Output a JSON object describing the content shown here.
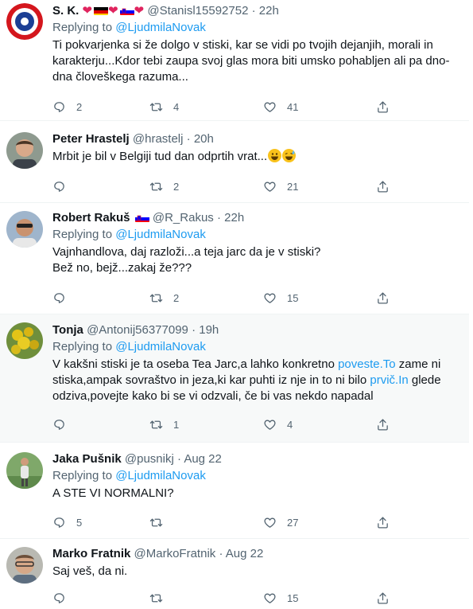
{
  "tweets": [
    {
      "name": "S. K.",
      "handle": "@Stanisl15592752",
      "time": "22h",
      "replying_prefix": "Replying to",
      "replying_to": "@LjudmilaNovak",
      "text": "Ti pokvarjenka si že dolgo v stiski, kar se vidi po tvojih dejanjih, morali in karakterju...Kdor tebi zaupa svoj glas mora biti umsko pohabljen ali pa dno-dna človeškega razuma...",
      "replies": "2",
      "retweets": "4",
      "likes": "41"
    },
    {
      "name": "Peter Hrastelj",
      "handle": "@hrastelj",
      "time": "20h",
      "text": "Mrbit je bil v Belgiji tud dan odprtih vrat...",
      "replies": "",
      "retweets": "2",
      "likes": "21"
    },
    {
      "name": "Robert Rakuš",
      "handle": "@R_Rakus",
      "time": "22h",
      "replying_prefix": "Replying to",
      "replying_to": "@LjudmilaNovak",
      "text_line1": "Vajnhandlova, daj razloži...a teja jarc da je v stiski?",
      "text_line2": "Bež no, bejž...zakaj že???",
      "replies": "",
      "retweets": "2",
      "likes": "15"
    },
    {
      "name": "Tonja",
      "handle": "@Antonij56377099",
      "time": "19h",
      "replying_prefix": "Replying to",
      "replying_to": "@LjudmilaNovak",
      "text_a": "V kakšni stiski je ta oseba Tea Jarc,a lahko konkretno ",
      "link1": "poveste.To",
      "text_b": " zame ni stiska,ampak sovraštvo in jeza,ki kar puhti iz nje in to ni bilo ",
      "link2": "prvič.In",
      "text_c": " glede odziva,povejte kako bi se vi odzvali, če bi vas nekdo napadal",
      "replies": "",
      "retweets": "1",
      "likes": "4"
    },
    {
      "name": "Jaka Pušnik",
      "handle": "@pusnikj",
      "time": "Aug 22",
      "replying_prefix": "Replying to",
      "replying_to": "@LjudmilaNovak",
      "text": "A STE VI NORMALNI?",
      "replies": "5",
      "retweets": "",
      "likes": "27"
    },
    {
      "name": "Marko Fratnik",
      "handle": "@MarkoFratnik",
      "time": "Aug 22",
      "text": "Saj veš, da ni.",
      "replies": "",
      "retweets": "",
      "likes": "15"
    }
  ],
  "dot": "·",
  "colors": {
    "link": "#1d9bf0",
    "muted": "#536471",
    "heart": "#e0245e",
    "highlight_bg": "#f7f9f9"
  },
  "icons": [
    "reply-icon",
    "retweet-icon",
    "like-icon",
    "share-icon",
    "more-icon"
  ]
}
